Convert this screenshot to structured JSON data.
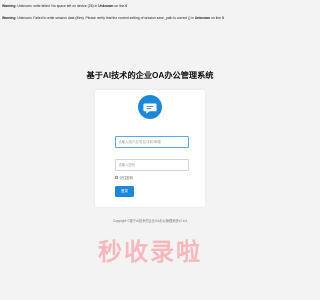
{
  "warnings": [
    {
      "label": "Warning",
      "message": ": Unknown: write failed: No space left on device (28) in ",
      "location_label": "Unknown",
      "line_text": " on line ",
      "line_number": "0"
    },
    {
      "label": "Warning",
      "message": ": Unknown: Failed to write session data (files). Please verify that the current setting of session.save_path is correct () in ",
      "location_label": "Unknown",
      "line_text": " on line ",
      "line_number": "0"
    }
  ],
  "header": {
    "title": "基于AI技术的企业OA办公管理系统"
  },
  "logo": {
    "icon": "chat-bubble-icon",
    "bg_color": "#1e88d8"
  },
  "login_form": {
    "username_placeholder": "请输入用户名/姓名/手机/邮箱",
    "username_value": "",
    "password_placeholder": "请输入密码",
    "password_value": "",
    "remember_label": "记住密码",
    "remember_checked": false,
    "submit_label": "登录",
    "accent_color": "#1e88d8"
  },
  "footer": {
    "copyright": "Copyright ©基于AI技术的企业OA办公管理系统v2.6.5"
  },
  "watermark": {
    "text": "秒收录啦"
  }
}
